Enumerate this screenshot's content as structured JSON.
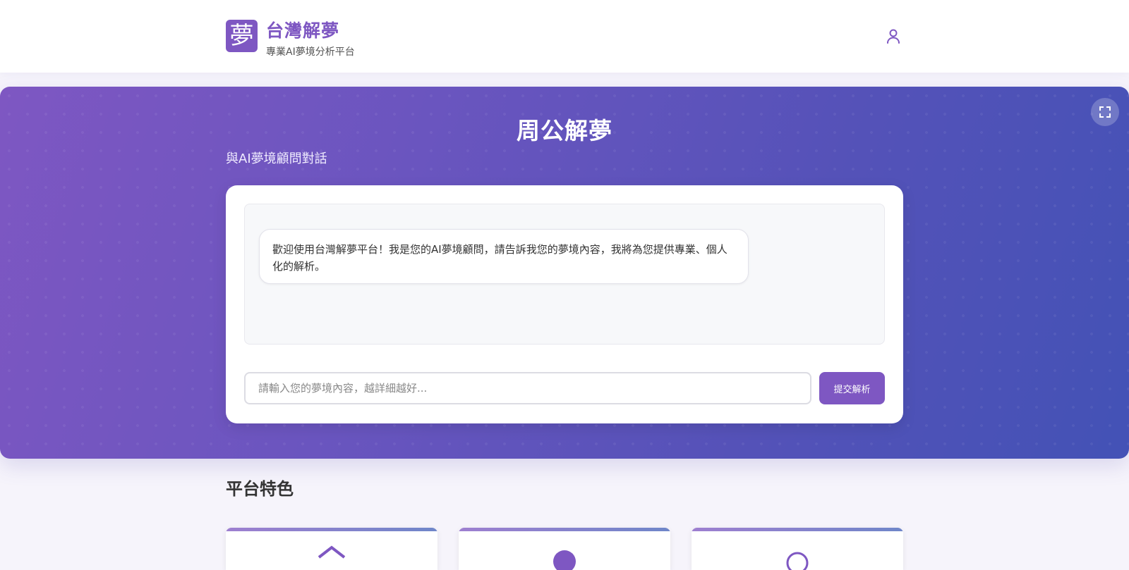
{
  "header": {
    "logo_char": "夢",
    "title": "台灣解夢",
    "subtitle": "專業AI夢境分析平台"
  },
  "hero": {
    "title": "周公解夢",
    "subtitle": "與AI夢境顧問對話"
  },
  "chat": {
    "welcome_message": "歡迎使用台灣解夢平台！我是您的AI夢境顧問，請告訴我您的夢境內容，我將為您提供專業、個人化的解析。",
    "input_placeholder": "請輸入您的夢境內容，越詳細越好...",
    "input_value": "",
    "submit_label": "提交解析"
  },
  "features": {
    "title": "平台特色",
    "cards": [
      {
        "icon": "shield-icon"
      },
      {
        "icon": "circle-icon"
      },
      {
        "icon": "circle-icon"
      }
    ]
  },
  "colors": {
    "brand": "#7e57c2",
    "hero_start": "#7e57c2",
    "hero_end": "#4352b6"
  },
  "icons": {
    "user": "user-icon",
    "fullscreen": "fullscreen-icon"
  }
}
